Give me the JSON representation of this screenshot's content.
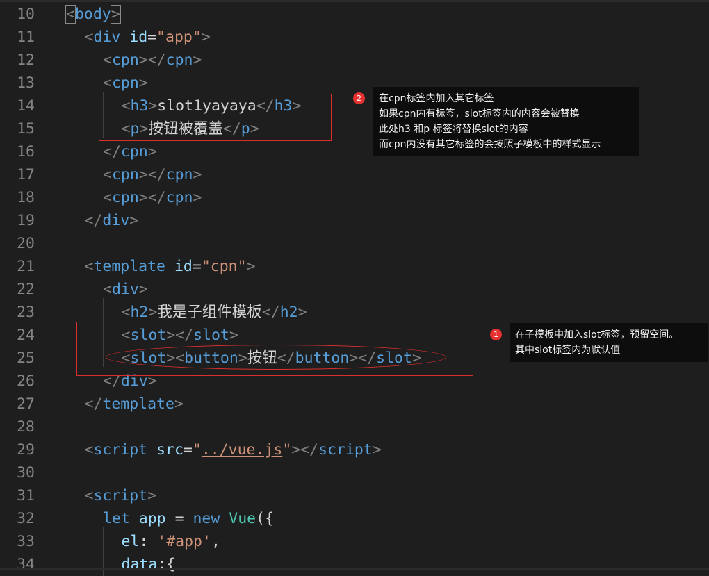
{
  "lines": [
    {
      "num": "10",
      "indent": 0,
      "tokens": [
        [
          "punc",
          "<"
        ],
        [
          "tag",
          "body"
        ],
        [
          "punc",
          ">"
        ]
      ]
    },
    {
      "num": "11",
      "indent": 1,
      "tokens": [
        [
          "punc",
          "<"
        ],
        [
          "tag",
          "div"
        ],
        [
          "text",
          " "
        ],
        [
          "attr",
          "id"
        ],
        [
          "text",
          "="
        ],
        [
          "str",
          "\"app\""
        ],
        [
          "punc",
          ">"
        ]
      ]
    },
    {
      "num": "12",
      "indent": 2,
      "tokens": [
        [
          "punc",
          "<"
        ],
        [
          "tag",
          "cpn"
        ],
        [
          "punc",
          "></"
        ],
        [
          "tag",
          "cpn"
        ],
        [
          "punc",
          ">"
        ]
      ]
    },
    {
      "num": "13",
      "indent": 2,
      "tokens": [
        [
          "punc",
          "<"
        ],
        [
          "tag",
          "cpn"
        ],
        [
          "punc",
          ">"
        ]
      ]
    },
    {
      "num": "14",
      "indent": 3,
      "tokens": [
        [
          "punc",
          "<"
        ],
        [
          "tag",
          "h3"
        ],
        [
          "punc",
          ">"
        ],
        [
          "text",
          "slot1yayaya"
        ],
        [
          "punc",
          "</"
        ],
        [
          "tag",
          "h3"
        ],
        [
          "punc",
          ">"
        ]
      ]
    },
    {
      "num": "15",
      "indent": 3,
      "tokens": [
        [
          "punc",
          "<"
        ],
        [
          "tag",
          "p"
        ],
        [
          "punc",
          ">"
        ],
        [
          "text",
          "按钮被覆盖"
        ],
        [
          "punc",
          "</"
        ],
        [
          "tag",
          "p"
        ],
        [
          "punc",
          ">"
        ]
      ]
    },
    {
      "num": "16",
      "indent": 2,
      "tokens": [
        [
          "punc",
          "</"
        ],
        [
          "tag",
          "cpn"
        ],
        [
          "punc",
          ">"
        ]
      ]
    },
    {
      "num": "17",
      "indent": 2,
      "tokens": [
        [
          "punc",
          "<"
        ],
        [
          "tag",
          "cpn"
        ],
        [
          "punc",
          "></"
        ],
        [
          "tag",
          "cpn"
        ],
        [
          "punc",
          ">"
        ]
      ]
    },
    {
      "num": "18",
      "indent": 2,
      "tokens": [
        [
          "punc",
          "<"
        ],
        [
          "tag",
          "cpn"
        ],
        [
          "punc",
          "></"
        ],
        [
          "tag",
          "cpn"
        ],
        [
          "punc",
          ">"
        ]
      ]
    },
    {
      "num": "19",
      "indent": 1,
      "tokens": [
        [
          "punc",
          "</"
        ],
        [
          "tag",
          "div"
        ],
        [
          "punc",
          ">"
        ]
      ]
    },
    {
      "num": "20",
      "indent": 0,
      "tokens": []
    },
    {
      "num": "21",
      "indent": 1,
      "tokens": [
        [
          "punc",
          "<"
        ],
        [
          "tag",
          "template"
        ],
        [
          "text",
          " "
        ],
        [
          "attr",
          "id"
        ],
        [
          "text",
          "="
        ],
        [
          "str",
          "\"cpn\""
        ],
        [
          "punc",
          ">"
        ]
      ]
    },
    {
      "num": "22",
      "indent": 2,
      "tokens": [
        [
          "punc",
          "<"
        ],
        [
          "tag",
          "div"
        ],
        [
          "punc",
          ">"
        ]
      ]
    },
    {
      "num": "23",
      "indent": 3,
      "tokens": [
        [
          "punc",
          "<"
        ],
        [
          "tag",
          "h2"
        ],
        [
          "punc",
          ">"
        ],
        [
          "text",
          "我是子组件模板"
        ],
        [
          "punc",
          "</"
        ],
        [
          "tag",
          "h2"
        ],
        [
          "punc",
          ">"
        ]
      ]
    },
    {
      "num": "24",
      "indent": 3,
      "tokens": [
        [
          "punc",
          "<"
        ],
        [
          "tag",
          "slot"
        ],
        [
          "punc",
          "></"
        ],
        [
          "tag",
          "slot"
        ],
        [
          "punc",
          ">"
        ]
      ]
    },
    {
      "num": "25",
      "indent": 3,
      "tokens": [
        [
          "punc",
          "<"
        ],
        [
          "tag",
          "slot"
        ],
        [
          "punc",
          "><"
        ],
        [
          "tag",
          "button"
        ],
        [
          "punc",
          ">"
        ],
        [
          "text",
          "按钮"
        ],
        [
          "punc",
          "</"
        ],
        [
          "tag",
          "button"
        ],
        [
          "punc",
          "></"
        ],
        [
          "tag",
          "slot"
        ],
        [
          "punc",
          ">"
        ]
      ]
    },
    {
      "num": "26",
      "indent": 2,
      "tokens": [
        [
          "punc",
          "</"
        ],
        [
          "tag",
          "div"
        ],
        [
          "punc",
          ">"
        ]
      ]
    },
    {
      "num": "27",
      "indent": 1,
      "tokens": [
        [
          "punc",
          "</"
        ],
        [
          "tag",
          "template"
        ],
        [
          "punc",
          ">"
        ]
      ]
    },
    {
      "num": "28",
      "indent": 0,
      "tokens": []
    },
    {
      "num": "29",
      "indent": 1,
      "tokens": [
        [
          "punc",
          "<"
        ],
        [
          "tag",
          "script"
        ],
        [
          "text",
          " "
        ],
        [
          "attr",
          "src"
        ],
        [
          "text",
          "="
        ],
        [
          "str",
          "\""
        ],
        [
          "link",
          "../vue.js"
        ],
        [
          "str",
          "\""
        ],
        [
          "punc",
          "></"
        ],
        [
          "tag",
          "script"
        ],
        [
          "punc",
          ">"
        ]
      ]
    },
    {
      "num": "30",
      "indent": 0,
      "tokens": []
    },
    {
      "num": "31",
      "indent": 1,
      "tokens": [
        [
          "punc",
          "<"
        ],
        [
          "tag",
          "script"
        ],
        [
          "punc",
          ">"
        ]
      ]
    },
    {
      "num": "32",
      "indent": 2,
      "tokens": [
        [
          "key",
          "let"
        ],
        [
          "text",
          " "
        ],
        [
          "var",
          "app"
        ],
        [
          "text",
          " = "
        ],
        [
          "key",
          "new"
        ],
        [
          "text",
          " "
        ],
        [
          "cls",
          "Vue"
        ],
        [
          "text",
          "({"
        ]
      ]
    },
    {
      "num": "33",
      "indent": 3,
      "tokens": [
        [
          "var",
          "el"
        ],
        [
          "text",
          ": "
        ],
        [
          "str",
          "'#app'"
        ],
        [
          "text",
          ","
        ]
      ]
    },
    {
      "num": "34",
      "indent": 3,
      "tokens": [
        [
          "var",
          "data"
        ],
        [
          "text",
          ":{"
        ]
      ]
    }
  ],
  "annotations": {
    "note2": {
      "badge": "2",
      "text": "在cpn标签内加入其它标签\n如果cpn内有标签，slot标签内的内容会被替换\n此处h3 和p 标签将替换slot的内容\n而cpn内没有其它标签的会按照子模板中的样式显示"
    },
    "note1": {
      "badge": "1",
      "text": "在子模板中加入slot标签，预留空间。\n其中slot标签内为默认值"
    }
  },
  "colors": {
    "background": "#1e1e1e",
    "tag": "#569cd6",
    "attr": "#9cdcfe",
    "string": "#ce9178",
    "annotation_red": "#d9302f"
  }
}
